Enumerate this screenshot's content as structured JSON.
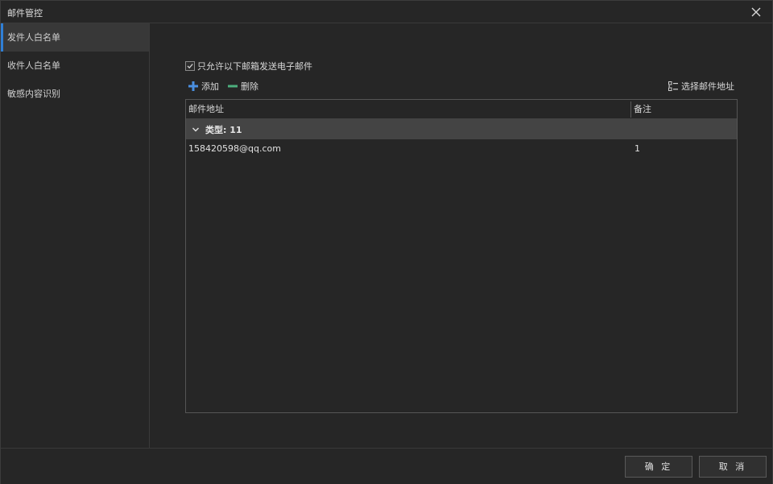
{
  "window": {
    "title": "邮件管控"
  },
  "sidebar": {
    "items": [
      {
        "label": "发件人白名单",
        "active": true
      },
      {
        "label": "收件人白名单",
        "active": false
      },
      {
        "label": "敏感内容识别",
        "active": false
      }
    ]
  },
  "main": {
    "checkbox": {
      "label": "只允许以下邮箱发送电子邮件",
      "checked": true
    },
    "toolbar": {
      "add_label": "添加",
      "delete_label": "删除",
      "select_label": "选择邮件地址"
    },
    "table": {
      "columns": [
        "邮件地址",
        "备注"
      ],
      "group": {
        "label": "类型: 11",
        "expanded": true
      },
      "rows": [
        {
          "email": "158420598@qq.com",
          "note": "1"
        }
      ]
    }
  },
  "footer": {
    "ok_label": "确 定",
    "cancel_label": "取 消"
  },
  "colors": {
    "accent": "#2f7fd6",
    "add_icon": "#4a8fe0",
    "delete_icon": "#4caf7d",
    "background": "#262626",
    "group_row": "#444444"
  },
  "icons": {
    "close": "close-icon",
    "check": "check-icon",
    "add": "plus-icon",
    "delete": "minus-icon",
    "select": "list-select-icon",
    "group_toggle": "chevron-down-icon"
  }
}
